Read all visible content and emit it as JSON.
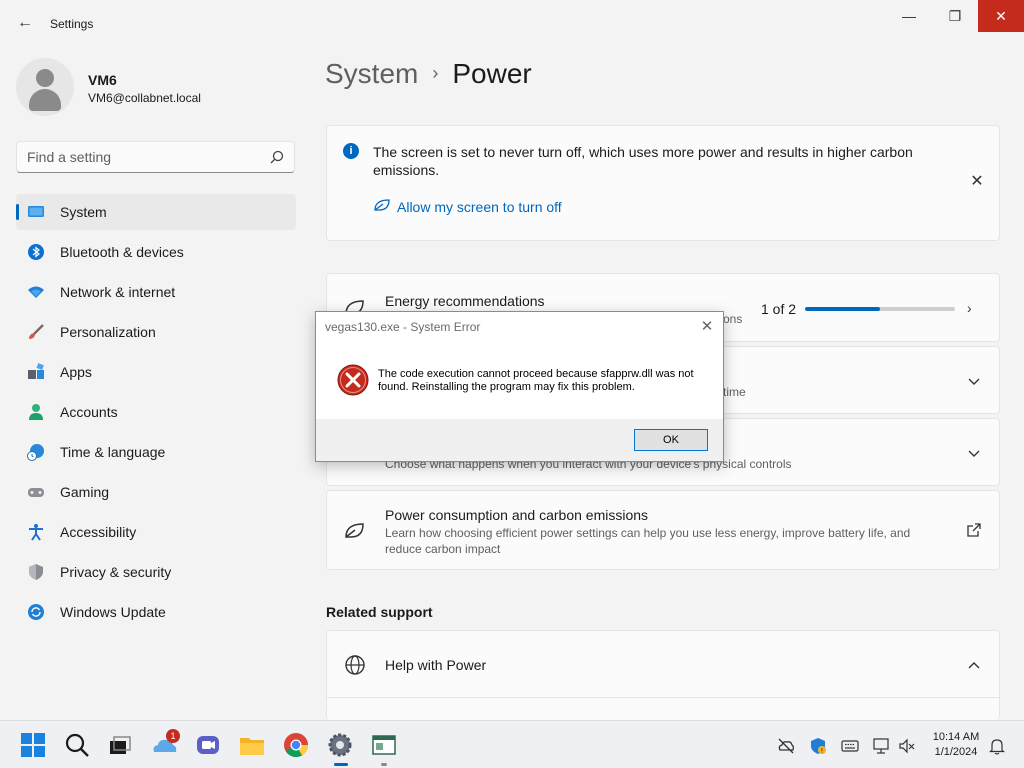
{
  "window": {
    "title": "Settings",
    "back_icon": "back-arrow-icon",
    "controls": [
      "minimize",
      "maximize",
      "close"
    ]
  },
  "profile": {
    "name": "VM6",
    "email": "VM6@collabnet.local"
  },
  "search": {
    "placeholder": "Find a setting"
  },
  "nav": {
    "items": [
      {
        "label": "System",
        "icon": "system-icon",
        "active": true
      },
      {
        "label": "Bluetooth & devices",
        "icon": "bluetooth-icon"
      },
      {
        "label": "Network & internet",
        "icon": "wifi-icon"
      },
      {
        "label": "Personalization",
        "icon": "brush-icon"
      },
      {
        "label": "Apps",
        "icon": "apps-icon"
      },
      {
        "label": "Accounts",
        "icon": "accounts-icon"
      },
      {
        "label": "Time & language",
        "icon": "globe-clock-icon"
      },
      {
        "label": "Gaming",
        "icon": "gamepad-icon"
      },
      {
        "label": "Accessibility",
        "icon": "accessibility-icon"
      },
      {
        "label": "Privacy & security",
        "icon": "shield-icon"
      },
      {
        "label": "Windows Update",
        "icon": "update-icon"
      }
    ]
  },
  "main": {
    "breadcrumb": {
      "parent": "System",
      "separator": "›",
      "current": "Power"
    },
    "info_banner": {
      "text": "The screen is set to never turn off, which uses more power and results in higher carbon emissions.",
      "link": "Allow my screen to turn off"
    },
    "energy": {
      "title": "Energy recommendations",
      "subtitle_partial": "ons",
      "progress_text": "1 of 2",
      "progress_fraction": 0.5
    },
    "screen_sleep": {
      "subtitle_partial": "time"
    },
    "lid_power": {
      "subtitle": "Choose what happens when you interact with your device's physical controls"
    },
    "carbon": {
      "title": "Power consumption and carbon emissions",
      "subtitle": "Learn how choosing efficient power settings can help you use less energy, improve battery life, and reduce carbon impact"
    },
    "related_support": {
      "heading": "Related support",
      "help_item": "Help with Power"
    }
  },
  "dialog": {
    "title": "vegas130.exe - System Error",
    "message": "The code execution cannot proceed because sfapprw.dll was not found. Reinstalling the program may fix this problem.",
    "ok_label": "OK"
  },
  "taskbar": {
    "apps": [
      "start-icon",
      "search-icon",
      "task-view-icon",
      "onedrive-icon",
      "meet-icon",
      "file-explorer-icon",
      "chrome-icon",
      "settings-icon",
      "app-window-icon"
    ],
    "notification_count": "1",
    "clock_time": "10:14 AM",
    "clock_date": "1/1/2024"
  },
  "colors": {
    "accent": "#0067c0",
    "close_red": "#c42b1c",
    "background": "#f3f3f3"
  }
}
